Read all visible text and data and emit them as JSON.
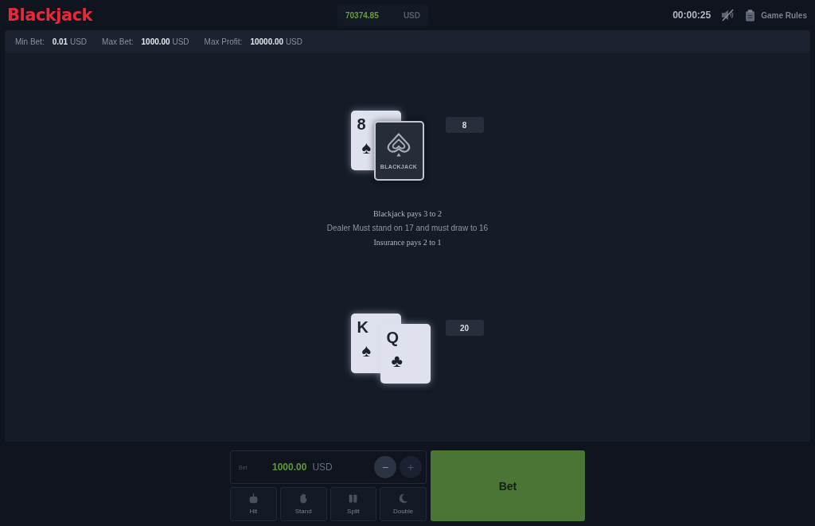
{
  "header": {
    "logo": "Blackjack",
    "balance": {
      "amount": "70374.85",
      "currency": "USD"
    },
    "timer": "00:00:25",
    "sound": {
      "on": false
    },
    "rules_link": "Game Rules"
  },
  "limits": [
    {
      "label": "Min Bet:",
      "value": "0.01",
      "currency": "USD"
    },
    {
      "label": "Max Bet:",
      "value": "1000.00",
      "currency": "USD"
    },
    {
      "label": "Max Profit:",
      "value": "10000.00",
      "currency": "USD"
    }
  ],
  "dealer": {
    "cards": [
      {
        "kind": "face",
        "rank": "8",
        "suit": "♠"
      },
      {
        "kind": "back",
        "label": "BLACKJACK"
      }
    ],
    "total": "8"
  },
  "rules": [
    "Blackjack pays 3 to 2",
    "Dealer Must stand on 17 and must draw to 16",
    "Insurance pays 2 to 1"
  ],
  "player": {
    "cards": [
      {
        "kind": "face",
        "rank": "K",
        "suit": "♠"
      },
      {
        "kind": "face",
        "rank": "Q",
        "suit": "♣"
      }
    ],
    "total": "20"
  },
  "bet": {
    "label": "Bet",
    "amount": "1000.00",
    "currency": "USD",
    "minus": {
      "label": "−",
      "disabled": false
    },
    "plus": {
      "label": "+",
      "disabled": true
    }
  },
  "actions": [
    {
      "kind": "hit",
      "label": "Hit",
      "disabled": true
    },
    {
      "kind": "stand",
      "label": "Stand",
      "disabled": true
    },
    {
      "kind": "split",
      "label": "Split",
      "disabled": true
    },
    {
      "kind": "double",
      "label": "Double",
      "disabled": true
    }
  ],
  "bet_button": "Bet"
}
